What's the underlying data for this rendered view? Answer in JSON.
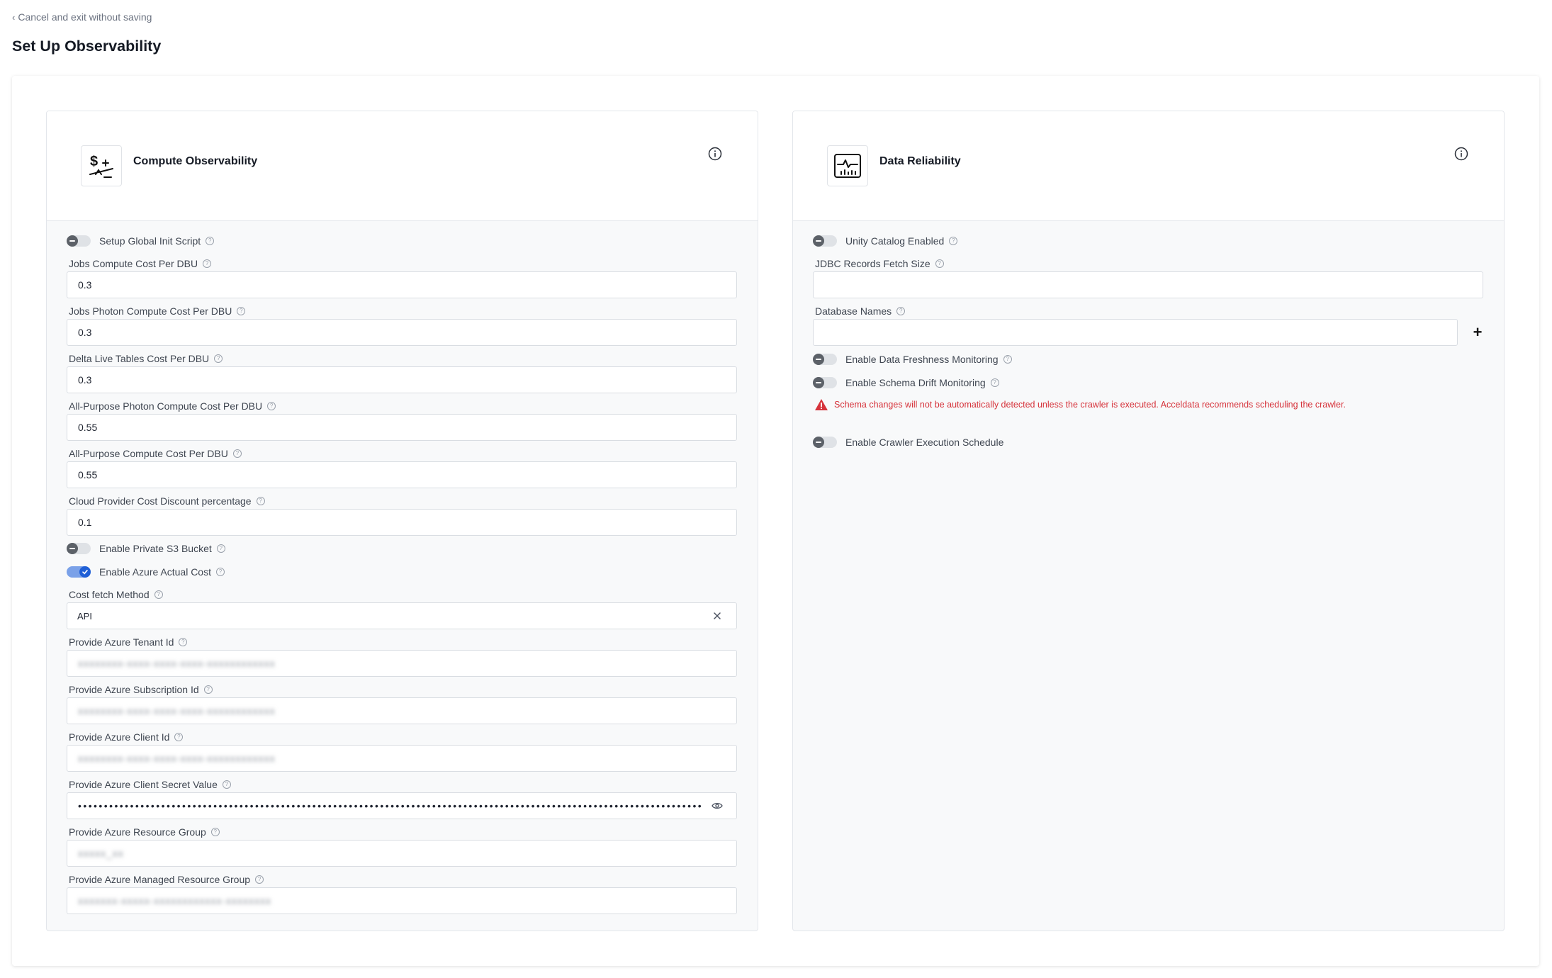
{
  "header": {
    "back_link": "Cancel and exit without saving",
    "title": "Set Up Observability"
  },
  "compute": {
    "title": "Compute Observability",
    "icon": "cost-scale-icon",
    "toggles": {
      "global_init": {
        "label": "Setup Global Init Script",
        "on": false
      },
      "private_s3": {
        "label": "Enable Private S3 Bucket",
        "on": false
      },
      "azure_actual_cost": {
        "label": "Enable Azure Actual Cost",
        "on": true
      }
    },
    "fields": [
      {
        "label": "Jobs Compute Cost Per DBU",
        "value": "0.3"
      },
      {
        "label": "Jobs Photon Compute Cost Per DBU",
        "value": "0.3"
      },
      {
        "label": "Delta Live Tables Cost Per DBU",
        "value": "0.3"
      },
      {
        "label": "All-Purpose Photon Compute Cost Per DBU",
        "value": "0.55"
      },
      {
        "label": "All-Purpose Compute Cost Per DBU",
        "value": "0.55"
      },
      {
        "label": "Cloud Provider Cost Discount percentage",
        "value": "0.1"
      }
    ],
    "cost_fetch": {
      "label": "Cost fetch Method",
      "value": "API"
    },
    "azure_fields": [
      {
        "label": "Provide Azure Tenant Id",
        "value": "xxxxxxxx-xxxx-xxxx-xxxx-xxxxxxxxxxxx"
      },
      {
        "label": "Provide Azure Subscription Id",
        "value": "xxxxxxxx-xxxx-xxxx-xxxx-xxxxxxxxxxxx"
      },
      {
        "label": "Provide Azure Client Id",
        "value": "xxxxxxxx-xxxx-xxxx-xxxx-xxxxxxxxxxxx"
      }
    ],
    "secret": {
      "label": "Provide Azure Client Secret Value",
      "value": "••••••••••••••••••••••••••••••••••••••••••••••••••••••••••••••••••••••••••••••••••••••••••••••••••••••••••••••••••••••••••••••••"
    },
    "resource_group": {
      "label": "Provide Azure Resource Group",
      "value": "xxxxx_xx"
    },
    "managed_resource_group": {
      "label": "Provide Azure Managed Resource Group",
      "value": "xxxxxxx-xxxxx-xxxxxxxxxxxx-xxxxxxxx"
    }
  },
  "reliability": {
    "title": "Data Reliability",
    "icon": "monitor-chart-icon",
    "toggles": {
      "unity_catalog": {
        "label": "Unity Catalog Enabled",
        "on": false
      },
      "freshness": {
        "label": "Enable Data Freshness Monitoring",
        "on": false
      },
      "schema_drift": {
        "label": "Enable Schema Drift Monitoring",
        "on": false
      },
      "crawler_schedule": {
        "label": "Enable Crawler Execution Schedule",
        "on": false
      }
    },
    "jdbc": {
      "label": "JDBC Records Fetch Size",
      "value": ""
    },
    "db_names": {
      "label": "Database Names",
      "value": ""
    },
    "warning": "Schema changes will not be automatically detected unless the crawler is executed. Acceldata recommends scheduling the crawler.",
    "colors": {
      "warning": "#d6333b",
      "toggle_on": "#1f5fd6"
    }
  }
}
